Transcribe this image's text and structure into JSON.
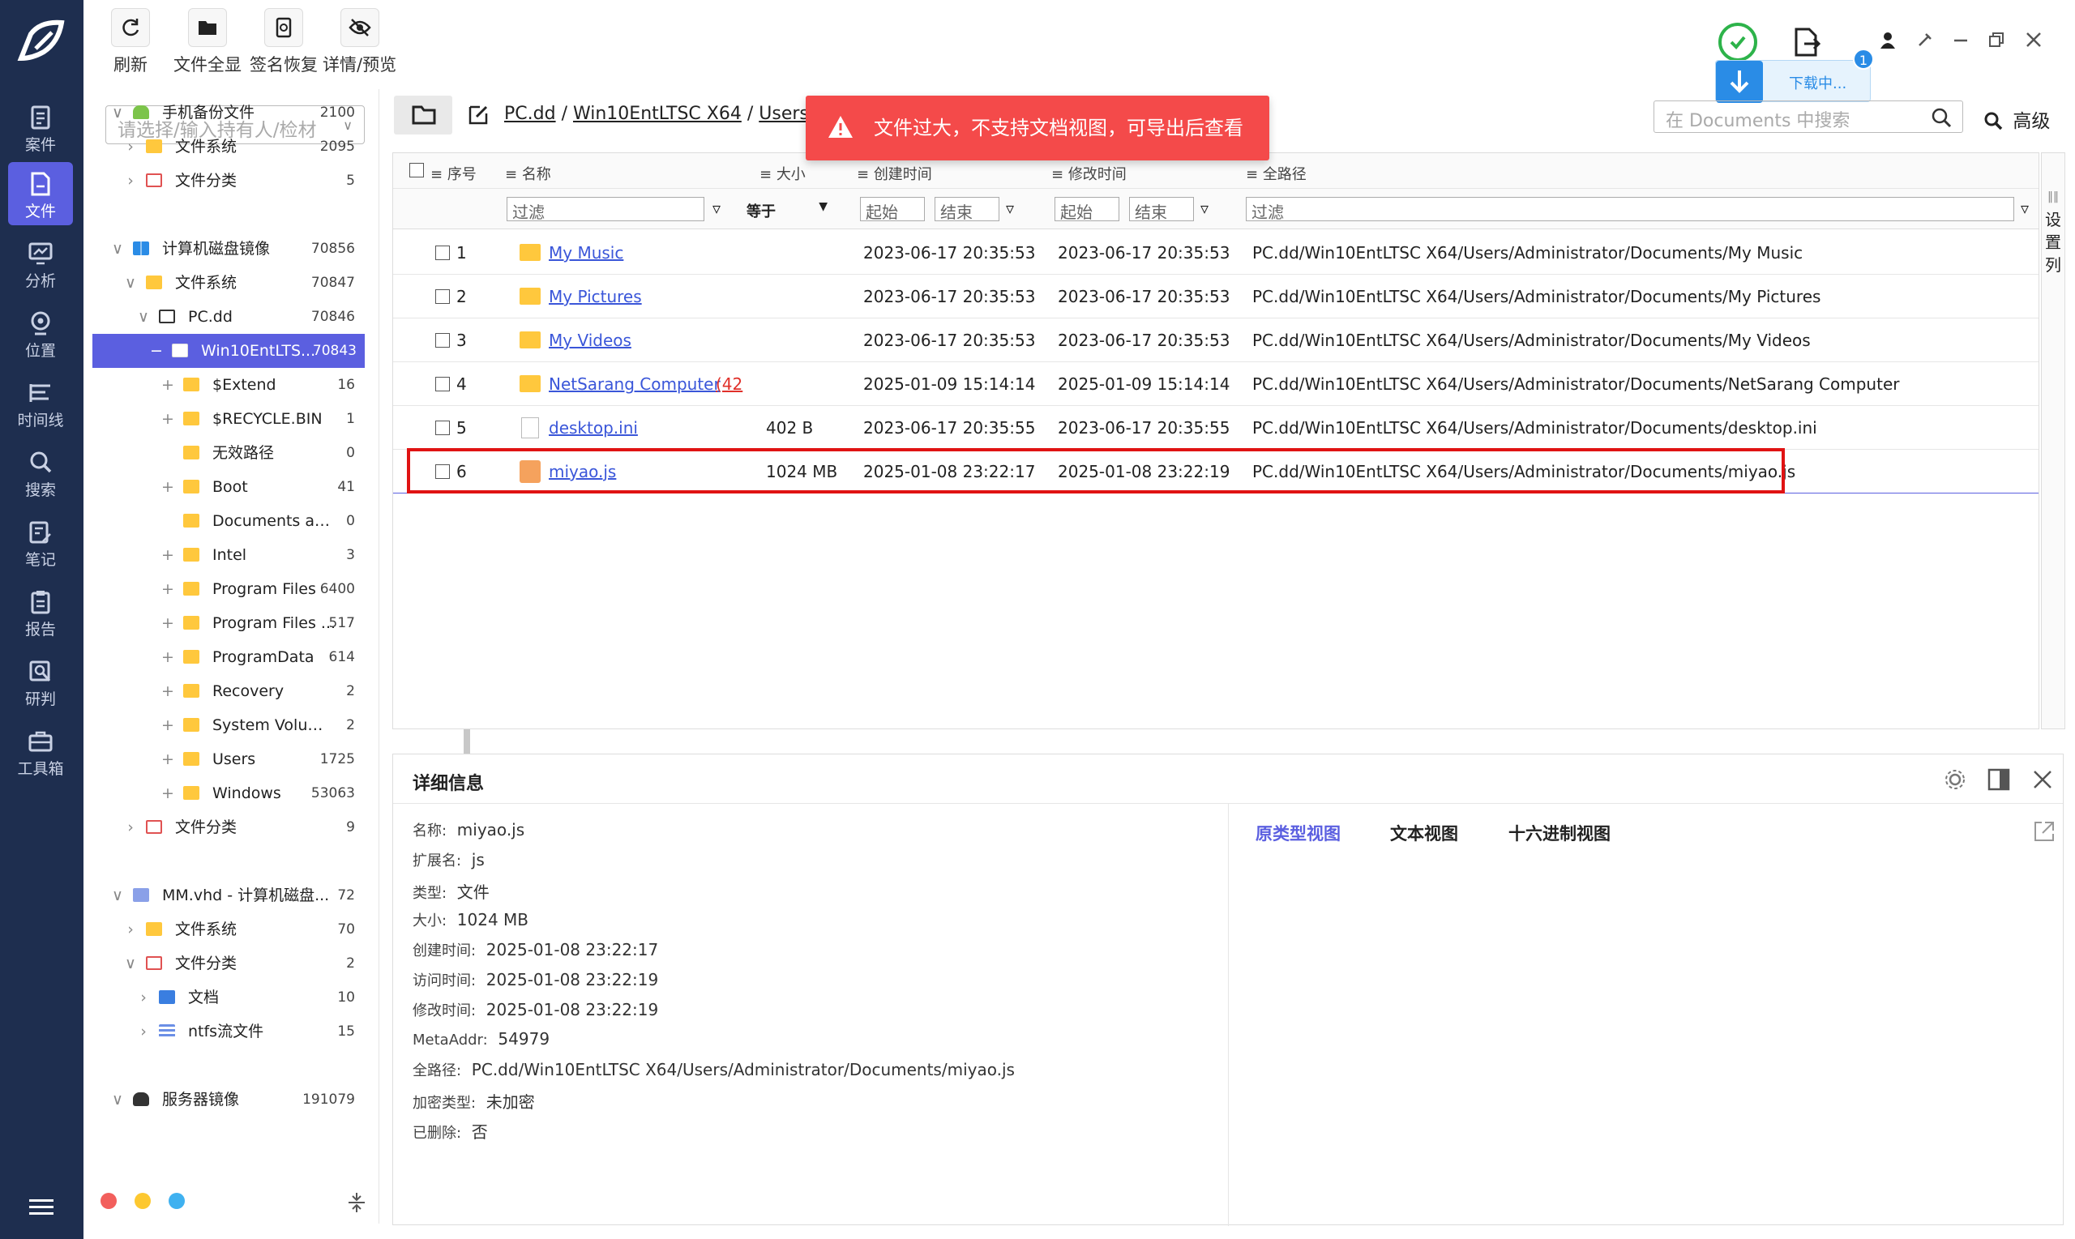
{
  "nav": {
    "items": [
      {
        "label": "案件",
        "icon": "case-icon"
      },
      {
        "label": "文件",
        "icon": "file-icon",
        "active": true
      },
      {
        "label": "分析",
        "icon": "analysis-icon"
      },
      {
        "label": "位置",
        "icon": "location-icon"
      },
      {
        "label": "时间线",
        "icon": "timeline-icon"
      },
      {
        "label": "搜索",
        "icon": "search-icon"
      },
      {
        "label": "笔记",
        "icon": "note-icon"
      },
      {
        "label": "报告",
        "icon": "report-icon"
      },
      {
        "label": "研判",
        "icon": "judge-icon"
      },
      {
        "label": "工具箱",
        "icon": "toolbox-icon"
      }
    ]
  },
  "toolbar": {
    "refresh": "刷新",
    "show_all": "文件全显",
    "sig_restore": "签名恢复",
    "detail_preview": "详情/预览"
  },
  "download": {
    "label": "下载中...",
    "badge": "1"
  },
  "left": {
    "owner_placeholder": "请选择/输入持有人/检材",
    "tree": [
      {
        "label": "手机备份文件",
        "count": "2100"
      },
      {
        "label": "文件系统",
        "count": "2095"
      },
      {
        "label": "文件分类",
        "count": "5"
      },
      {
        "label": "计算机磁盘镜像",
        "count": "70856"
      },
      {
        "label": "文件系统",
        "count": "70847"
      },
      {
        "label": "PC.dd",
        "count": "70846"
      },
      {
        "label": "Win10EntLTS...",
        "count": "70843"
      },
      {
        "label": "$Extend",
        "count": "16"
      },
      {
        "label": "$RECYCLE.BIN",
        "count": "1"
      },
      {
        "label": "无效路径",
        "count": "0"
      },
      {
        "label": "Boot",
        "count": "41"
      },
      {
        "label": "Documents and ...",
        "count": "0"
      },
      {
        "label": "Intel",
        "count": "3"
      },
      {
        "label": "Program Files",
        "count": "6400"
      },
      {
        "label": "Program Files ...",
        "count": "517"
      },
      {
        "label": "ProgramData",
        "count": "614"
      },
      {
        "label": "Recovery",
        "count": "2"
      },
      {
        "label": "System Volume ...",
        "count": "2"
      },
      {
        "label": "Users",
        "count": "1725"
      },
      {
        "label": "Windows",
        "count": "53063"
      },
      {
        "label": "文件分类",
        "count": "9"
      },
      {
        "label": "MM.vhd - 计算机磁盘...",
        "count": "72"
      },
      {
        "label": "文件系统",
        "count": "70"
      },
      {
        "label": "文件分类",
        "count": "2"
      },
      {
        "label": "文档",
        "count": "10"
      },
      {
        "label": "ntfs流文件",
        "count": "15"
      },
      {
        "label": "服务器镜像",
        "count": "191079"
      }
    ]
  },
  "breadcrumb": {
    "p1": "PC.dd",
    "p2": "Win10EntLTSC X64",
    "p3": "Users",
    "sep": "/"
  },
  "search": {
    "placeholder": "在 Documents 中搜索",
    "advanced": "高级"
  },
  "toast": "文件过大，不支持文档视图，可导出后查看",
  "table": {
    "headers": {
      "seq": "序号",
      "name": "名称",
      "size": "大小",
      "created": "创建时间",
      "modified": "修改时间",
      "path": "全路径"
    },
    "filters": {
      "filter": "过滤",
      "equal": "等于",
      "start": "起始",
      "end": "结束"
    },
    "rows": [
      {
        "seq": "1",
        "name": "My Music",
        "size": "",
        "created": "2023-06-17 20:35:53",
        "modified": "2023-06-17 20:35:53",
        "path": "PC.dd/Win10EntLTSC X64/Users/Administrator/Documents/My Music"
      },
      {
        "seq": "2",
        "name": "My Pictures",
        "size": "",
        "created": "2023-06-17 20:35:53",
        "modified": "2023-06-17 20:35:53",
        "path": "PC.dd/Win10EntLTSC X64/Users/Administrator/Documents/My Pictures"
      },
      {
        "seq": "3",
        "name": "My Videos",
        "size": "",
        "created": "2023-06-17 20:35:53",
        "modified": "2023-06-17 20:35:53",
        "path": "PC.dd/Win10EntLTSC X64/Users/Administrator/Documents/My Videos"
      },
      {
        "seq": "4",
        "name": "NetSarang Computer",
        "extra": "(42",
        "size": "",
        "created": "2025-01-09 15:14:14",
        "modified": "2025-01-09 15:14:14",
        "path": "PC.dd/Win10EntLTSC X64/Users/Administrator/Documents/NetSarang Computer"
      },
      {
        "seq": "5",
        "name": "desktop.ini",
        "size": "402 B",
        "created": "2023-06-17 20:35:55",
        "modified": "2023-06-17 20:35:55",
        "path": "PC.dd/Win10EntLTSC X64/Users/Administrator/Documents/desktop.ini"
      },
      {
        "seq": "6",
        "name": "miyao.js",
        "size": "1024 MB",
        "created": "2025-01-08 23:22:17",
        "modified": "2025-01-08 23:22:19",
        "path": "PC.dd/Win10EntLTSC X64/Users/Administrator/Documents/miyao.js"
      }
    ],
    "side_label": "设置列"
  },
  "detail": {
    "title": "详细信息",
    "fields": [
      {
        "k": "名称:",
        "v": "miyao.js"
      },
      {
        "k": "扩展名:",
        "v": "js"
      },
      {
        "k": "类型:",
        "v": "文件"
      },
      {
        "k": "大小:",
        "v": "1024 MB"
      },
      {
        "k": "创建时间:",
        "v": "2025-01-08 23:22:17"
      },
      {
        "k": "访问时间:",
        "v": "2025-01-08 23:22:19"
      },
      {
        "k": "修改时间:",
        "v": "2025-01-08 23:22:19"
      },
      {
        "k": "MetaAddr:",
        "v": "54979"
      },
      {
        "k": "全路径:",
        "v": "PC.dd/Win10EntLTSC X64/Users/Administrator/Documents/miyao.js"
      },
      {
        "k": "加密类型:",
        "v": "未加密"
      },
      {
        "k": "已删除:",
        "v": "否"
      }
    ],
    "tabs": [
      "原类型视图",
      "文本视图",
      "十六进制视图"
    ]
  },
  "colors": {
    "rail": "#1e2e4f",
    "accent": "#5b5fe0",
    "toast": "#f44a4a",
    "highlight": "#e01313",
    "link": "#3a56d9",
    "folder": "#ffc83d"
  }
}
